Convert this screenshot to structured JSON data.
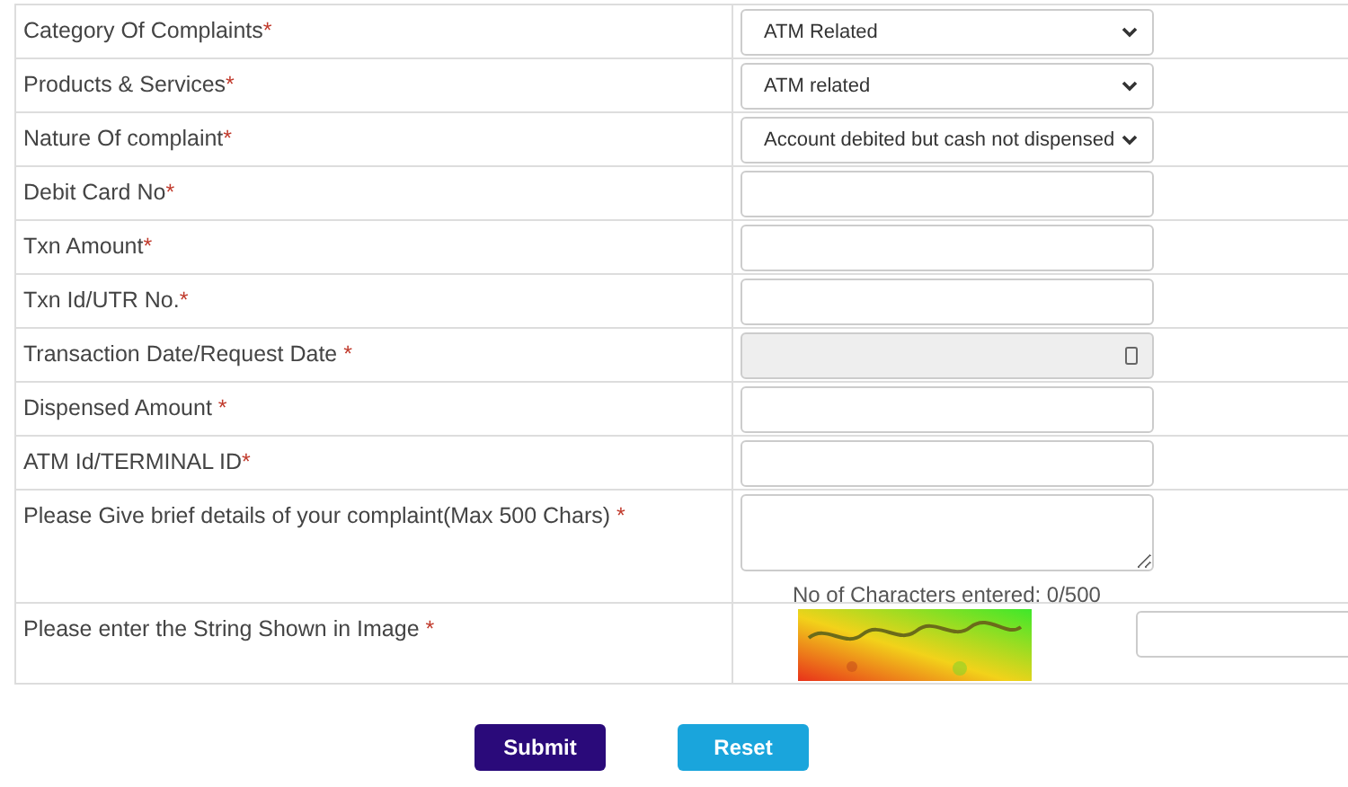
{
  "form": {
    "rows": [
      {
        "label": "Category Of Complaints",
        "mark": "*",
        "kind": "select",
        "value": "ATM Related"
      },
      {
        "label": "Products & Services",
        "mark": "*",
        "kind": "select",
        "value": "ATM related"
      },
      {
        "label": "Nature Of complaint",
        "mark": "*",
        "kind": "select",
        "value": "Account debited but cash not dispensed"
      },
      {
        "label": "Debit Card No",
        "mark": "*",
        "kind": "text"
      },
      {
        "label": "Txn Amount",
        "mark": "*",
        "kind": "text"
      },
      {
        "label": "Txn Id/UTR No.",
        "mark": "*",
        "kind": "text"
      },
      {
        "label": "Transaction Date/Request Date",
        "mark": " *",
        "kind": "date",
        "disabled": true
      },
      {
        "label": "Dispensed Amount",
        "mark": " *",
        "kind": "text"
      },
      {
        "label": "ATM Id/TERMINAL ID",
        "mark": "*",
        "kind": "text"
      },
      {
        "label": "Please Give brief details of your complaint(Max 500 Chars)",
        "mark": " *",
        "kind": "textarea",
        "counter": "No of Characters entered: 0/500"
      },
      {
        "label": "Please enter the String Shown in Image",
        "mark": " *",
        "kind": "captcha"
      }
    ]
  },
  "buttons": [
    {
      "label": "Submit",
      "kind": "primary"
    },
    {
      "label": "Reset",
      "kind": "secondary"
    }
  ]
}
